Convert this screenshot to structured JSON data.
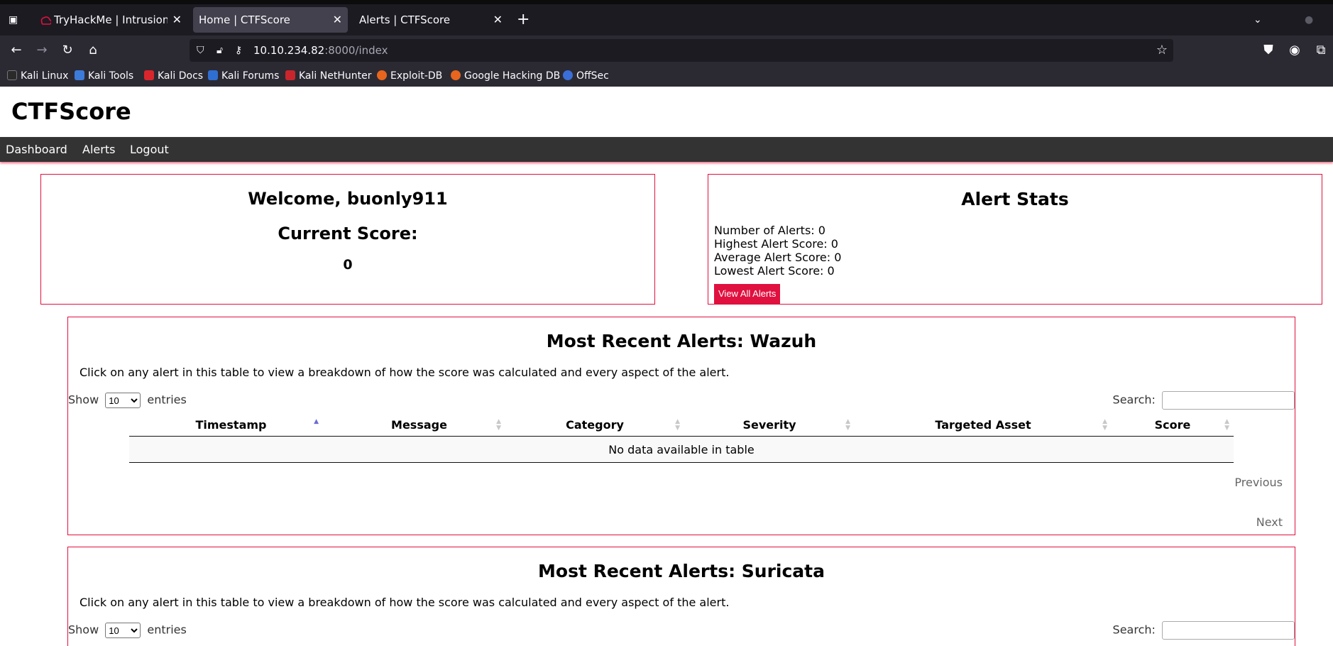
{
  "browser": {
    "tabs": [
      {
        "title": "TryHackMe | Intrusion Det",
        "active": false
      },
      {
        "title": "Home | CTFScore",
        "active": true
      },
      {
        "title": "Alerts | CTFScore",
        "active": false
      }
    ],
    "url_host": "10.10.234.82",
    "url_rest": ":8000/index",
    "bookmarks": [
      "Kali Linux",
      "Kali Tools",
      "Kali Docs",
      "Kali Forums",
      "Kali NetHunter",
      "Exploit-DB",
      "Google Hacking DB",
      "OffSec"
    ]
  },
  "site": {
    "title": "CTFScore",
    "nav": [
      "Dashboard",
      "Alerts",
      "Logout"
    ]
  },
  "welcome": {
    "heading": "Welcome, buonly911",
    "score_label": "Current Score:",
    "score_value": "0"
  },
  "stats": {
    "heading": "Alert Stats",
    "lines": [
      "Number of Alerts: 0",
      "Highest Alert Score: 0",
      "Average Alert Score: 0",
      "Lowest Alert Score: 0"
    ],
    "button": "View All Alerts"
  },
  "sections": [
    {
      "title": "Most Recent Alerts: Wazuh",
      "description": "Click on any alert in this table to view a breakdown of how the score was calculated and every aspect of the alert.",
      "show_label": "Show",
      "show_value": "10",
      "entries_label": "entries",
      "search_label": "Search:",
      "columns": [
        "Timestamp",
        "Message",
        "Category",
        "Severity",
        "Targeted Asset",
        "Score"
      ],
      "empty_text": "No data available in table",
      "previous": "Previous",
      "next": "Next"
    },
    {
      "title": "Most Recent Alerts: Suricata",
      "description": "Click on any alert in this table to view a breakdown of how the score was calculated and every aspect of the alert.",
      "show_label": "Show",
      "show_value": "10",
      "entries_label": "entries",
      "search_label": "Search:"
    }
  ],
  "colors": {
    "accent": "#e0113f",
    "nav_bg": "#333333",
    "browser_dark": "#1c1b22"
  }
}
